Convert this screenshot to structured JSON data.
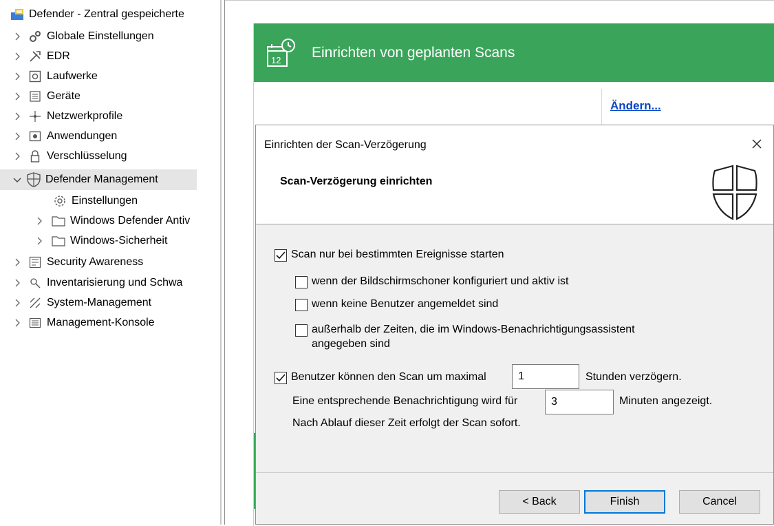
{
  "tree": {
    "root": "Defender - Zentral gespeicherte",
    "items": [
      {
        "label": "Globale Einstellungen",
        "icon": "gears-icon"
      },
      {
        "label": "EDR",
        "icon": "tools-icon"
      },
      {
        "label": "Laufwerke",
        "icon": "drive-icon"
      },
      {
        "label": "Geräte",
        "icon": "devices-icon"
      },
      {
        "label": "Netzwerkprofile",
        "icon": "network-icon"
      },
      {
        "label": "Anwendungen",
        "icon": "application-icon"
      },
      {
        "label": "Verschlüsselung",
        "icon": "lock-icon"
      },
      {
        "label": "Defender Management",
        "icon": "shield-icon"
      },
      {
        "label": "Einstellungen",
        "icon": "gear-icon"
      },
      {
        "label": "Windows Defender Antiv",
        "icon": "folder-icon"
      },
      {
        "label": "Windows-Sicherheit",
        "icon": "folder-icon"
      },
      {
        "label": "Security Awareness",
        "icon": "awareness-icon"
      },
      {
        "label": "Inventarisierung und Schwa",
        "icon": "inventory-icon"
      },
      {
        "label": "System-Management",
        "icon": "system-management-icon"
      },
      {
        "label": "Management-Konsole",
        "icon": "console-icon"
      }
    ]
  },
  "wizard": {
    "title": "Einrichten von geplanten Scans",
    "change_link": "Ändern..."
  },
  "dialog": {
    "title": "Einrichten der Scan-Verzögerung",
    "subtitle": "Scan-Verzögerung einrichten",
    "cb_main": "Scan nur bei bestimmten Ereignisse starten",
    "cb_screensaver": "wenn der Bildschirmschoner konfiguriert und aktiv ist",
    "cb_no_users": "wenn keine Benutzer angemeldet sind",
    "cb_outside_line1": "außerhalb der Zeiten, die im Windows-Benachrichtigungsassistent",
    "cb_outside_line2": "angegeben sind",
    "delay_prefix": "Benutzer können den Scan um maximal",
    "delay_value": "1",
    "delay_suffix": "Stunden verzögern.",
    "notify_prefix": "Eine entsprechende Benachrichtigung wird für",
    "notify_value": "3",
    "notify_suffix": "Minuten angezeigt.",
    "after_note": "Nach Ablauf dieser Zeit erfolgt der Scan sofort.",
    "buttons": {
      "back": "< Back",
      "finish": "Finish",
      "cancel": "Cancel"
    }
  },
  "colors": {
    "accent_green": "#3aa55a",
    "link_blue": "#0645c4",
    "focus_blue": "#0078d7"
  }
}
